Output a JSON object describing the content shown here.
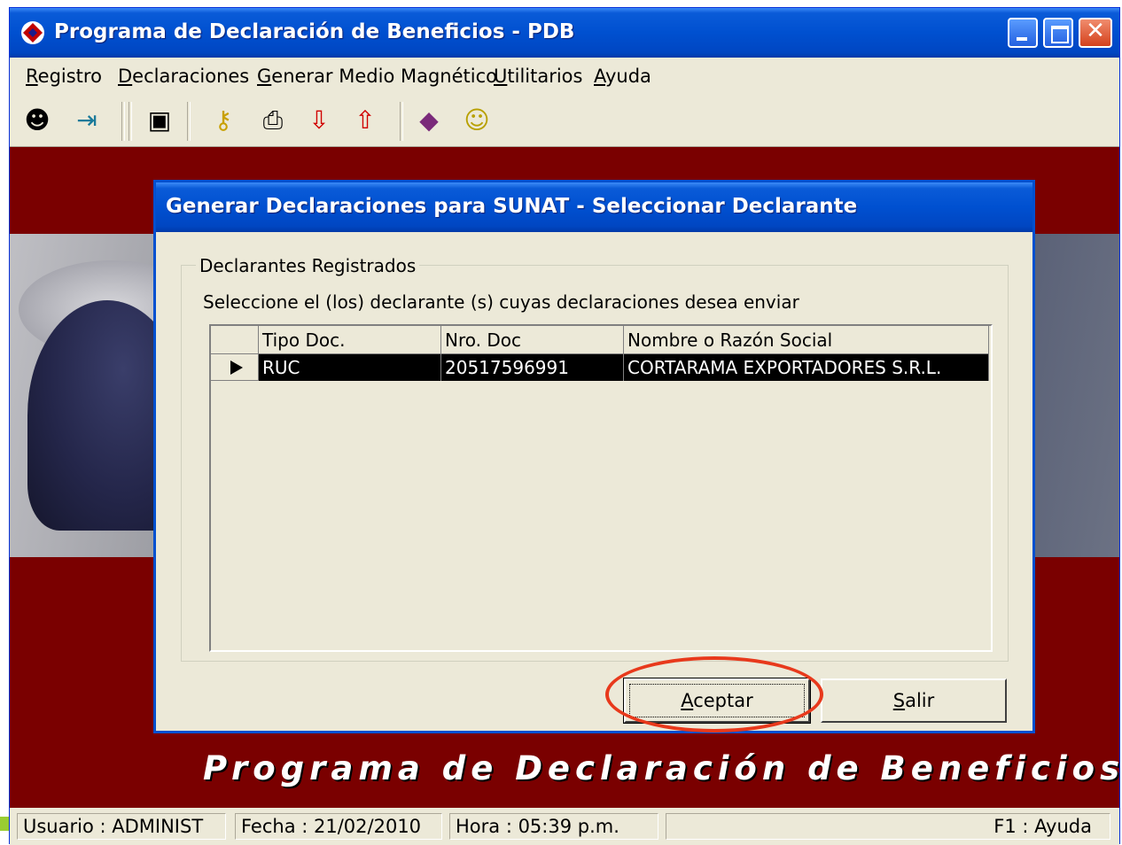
{
  "window": {
    "title": "Programa de Declaración de Beneficios - PDB",
    "close_glyph": "✕"
  },
  "menu": [
    {
      "prefix": "",
      "accel": "R",
      "rest": "egistro"
    },
    {
      "prefix": "",
      "accel": "D",
      "rest": "eclaraciones"
    },
    {
      "prefix": "",
      "accel": "G",
      "rest": "enerar Medio Magnético"
    },
    {
      "prefix": "",
      "accel": "U",
      "rest": "tilitarios"
    },
    {
      "prefix": "",
      "accel": "A",
      "rest": "yuda"
    }
  ],
  "toolbar": {
    "icons": [
      "user-icon",
      "exit-icon",
      "save-icon",
      "key-icon",
      "print-icon",
      "download-icon",
      "upload-icon",
      "help-book-icon",
      "smiley-icon"
    ],
    "glyphs": {
      "user": "☻",
      "exit": "⇥",
      "save": "▣",
      "key": "⚷",
      "print": "⎙",
      "download": "⇩",
      "upload": "⇧",
      "book": "◆",
      "smiley": "☺"
    }
  },
  "background": {
    "banner_text": "Programa de Declaración de Beneficios - PDB"
  },
  "dialog": {
    "title": "Generar Declaraciones para SUNAT - Seleccionar Declarante",
    "group_label": "Declarantes Registrados",
    "instruction": "Seleccione el (los) declarante (s) cuyas declaraciones desea enviar",
    "columns": [
      "Tipo Doc.",
      "Nro. Doc",
      "Nombre o Razón Social"
    ],
    "rows": [
      {
        "tipo": "RUC",
        "nro": "20517596991",
        "nombre": "CORTARAMA EXPORTADORES S.R.L.",
        "selected": true
      }
    ],
    "buttons": {
      "accept": {
        "accel": "A",
        "rest": "ceptar"
      },
      "exit": {
        "accel": "S",
        "rest": "alir"
      }
    }
  },
  "status": {
    "user": "Usuario : ADMINIST",
    "date": "Fecha : 21/02/2010",
    "time": "Hora : 05:39 p.m.",
    "help": "F1 : Ayuda"
  },
  "colors": {
    "titlebar": "#0050d0",
    "background_red": "#7a0000",
    "highlight_ring": "#e8391c",
    "selection": "#000000"
  }
}
